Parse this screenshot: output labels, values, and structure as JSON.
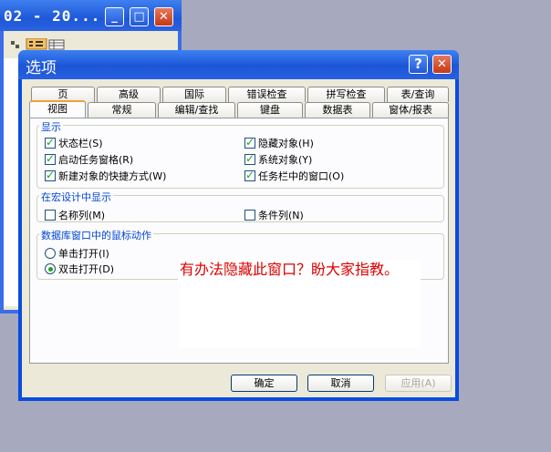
{
  "bg_window": {
    "title": "02 - 20...",
    "min": "_",
    "max": "□",
    "close": "✕"
  },
  "dialog": {
    "title": "选项",
    "help": "?",
    "close": "✕",
    "tabs_row1": [
      "页",
      "高级",
      "国际",
      "错误检查",
      "拼写检查",
      "表/查询"
    ],
    "tabs_row2": [
      "视图",
      "常规",
      "编辑/查找",
      "键盘",
      "数据表",
      "窗体/报表"
    ],
    "groups": {
      "display": {
        "label": "显示",
        "items": [
          {
            "label": "状态栏(S)",
            "checked": true
          },
          {
            "label": "隐藏对象(H)",
            "checked": true
          },
          {
            "label": "启动任务窗格(R)",
            "checked": true
          },
          {
            "label": "系统对象(Y)",
            "checked": true
          },
          {
            "label": "新建对象的快捷方式(W)",
            "checked": true
          },
          {
            "label": "任务栏中的窗口(O)",
            "checked": true
          }
        ]
      },
      "macro": {
        "label": "在宏设计中显示",
        "items": [
          {
            "label": "名称列(M)",
            "checked": false
          },
          {
            "label": "条件列(N)",
            "checked": false
          }
        ]
      },
      "mouse": {
        "label": "数据库窗口中的鼠标动作",
        "items": [
          {
            "label": "单击打开(I)",
            "checked": false
          },
          {
            "label": "双击打开(D)",
            "checked": true
          }
        ]
      }
    },
    "buttons": {
      "ok": "确定",
      "cancel": "取消",
      "apply": "应用(A)"
    }
  },
  "annotation": "有办法隐藏此窗口？盼大家指教。"
}
